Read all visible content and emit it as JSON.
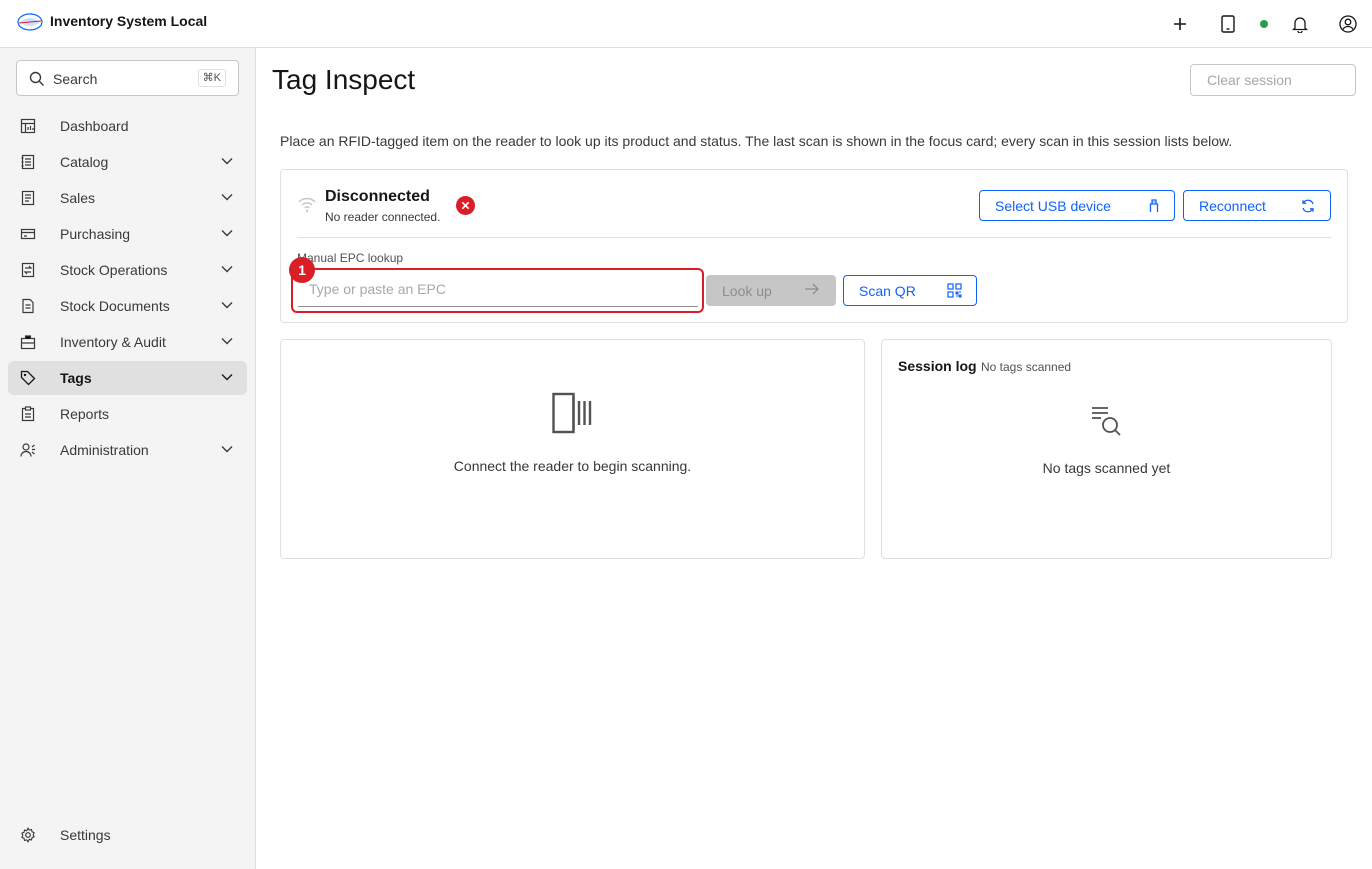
{
  "app": {
    "title": "Inventory System Local"
  },
  "header": {
    "icons": [
      "plus-icon",
      "tablet-icon",
      "status-dot",
      "bell-icon",
      "user-icon"
    ],
    "status_color": "#24a148"
  },
  "sidebar": {
    "search": {
      "label": "Search",
      "shortcut": "⌘K"
    },
    "items": [
      {
        "label": "Dashboard",
        "icon": "dashboard-icon",
        "expandable": false
      },
      {
        "label": "Catalog",
        "icon": "catalog-icon",
        "expandable": true
      },
      {
        "label": "Sales",
        "icon": "sales-icon",
        "expandable": true
      },
      {
        "label": "Purchasing",
        "icon": "purchasing-icon",
        "expandable": true
      },
      {
        "label": "Stock Operations",
        "icon": "stock-operations-icon",
        "expandable": true
      },
      {
        "label": "Stock Documents",
        "icon": "stock-documents-icon",
        "expandable": true
      },
      {
        "label": "Inventory & Audit",
        "icon": "inventory-audit-icon",
        "expandable": true
      },
      {
        "label": "Tags",
        "icon": "tag-icon",
        "expandable": true,
        "active": true
      },
      {
        "label": "Reports",
        "icon": "reports-icon",
        "expandable": false
      },
      {
        "label": "Administration",
        "icon": "administration-icon",
        "expandable": true
      }
    ],
    "settings_label": "Settings"
  },
  "page": {
    "title": "Tag Inspect",
    "clear_session": "Clear session",
    "intro": "Place an RFID-tagged item on the reader to look up its product and status. The last scan is shown in the focus card; every scan in this session lists below."
  },
  "reader": {
    "status": "Disconnected",
    "status_detail": "No reader connected.",
    "select_usb": "Select USB device",
    "reconnect": "Reconnect",
    "error_color": "#da1e28"
  },
  "epc": {
    "label": "Manual EPC lookup",
    "placeholder": "Type or paste an EPC",
    "value": "",
    "badge": "1",
    "lookup": "Look up",
    "scan_qr": "Scan QR"
  },
  "focus": {
    "message": "Connect the reader to begin scanning."
  },
  "log": {
    "title": "Session log",
    "count": "No tags scanned",
    "empty": "No tags scanned yet"
  },
  "colors": {
    "accent": "#0f62fe",
    "error": "#da1e28",
    "success": "#24a148"
  }
}
